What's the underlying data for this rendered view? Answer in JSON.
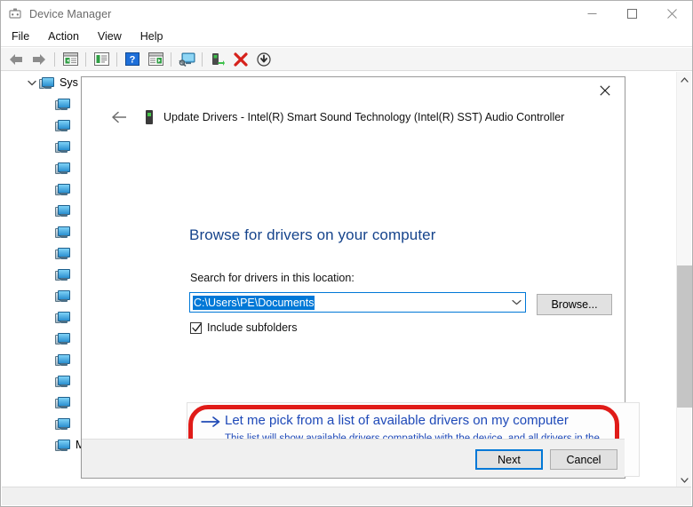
{
  "window": {
    "title": "Device Manager",
    "icon": "device-manager-icon",
    "controls": {
      "minimize": "minimize-icon",
      "maximize": "maximize-icon",
      "close": "close-icon"
    }
  },
  "menubar": {
    "items": [
      {
        "label": "File"
      },
      {
        "label": "Action"
      },
      {
        "label": "View"
      },
      {
        "label": "Help"
      }
    ]
  },
  "toolbar": {
    "buttons": [
      {
        "name": "back-icon",
        "title": "Back"
      },
      {
        "name": "forward-icon",
        "title": "Forward"
      },
      {
        "name": "show-hide-console-tree-icon",
        "title": "Show/Hide Console Tree"
      },
      {
        "name": "properties-icon",
        "title": "Properties"
      },
      {
        "name": "help-icon",
        "title": "Help"
      },
      {
        "name": "update-driver-icon",
        "title": "Update driver"
      },
      {
        "name": "scan-for-hardware-changes-icon",
        "title": "Scan for hardware changes"
      },
      {
        "name": "uninstall-device-icon",
        "title": "Uninstall device"
      },
      {
        "name": "disable-device-icon",
        "title": "Disable device"
      },
      {
        "name": "enable-device-icon",
        "title": "Enable device"
      }
    ]
  },
  "tree": {
    "root_label": "Sys",
    "item_count": 17,
    "last_item_label": "Microsoft UEFI-Compliant System",
    "chevron": "chevron-down-icon",
    "device_icon": "system-device-icon"
  },
  "scrollbar": {
    "up_arrow": "scroll-up-icon",
    "down_arrow": "scroll-down-icon"
  },
  "dialog": {
    "close_icon": "close-icon",
    "back_icon": "back-arrow-icon",
    "device_icon": "device-icon",
    "title": "Update Drivers - Intel(R) Smart Sound Technology (Intel(R) SST) Audio Controller",
    "heading": "Browse for drivers on your computer",
    "search_label": "Search for drivers in this location:",
    "location_value": "C:\\Users\\PE\\Documents",
    "location_placeholder": "",
    "dropdown_icon": "chevron-down-icon",
    "browse_label": "Browse...",
    "include_subfolders_label": "Include subfolders",
    "include_subfolders_checked": true,
    "option": {
      "arrow_icon": "arrow-right-icon",
      "title": "Let me pick from a list of available drivers on my computer",
      "description": "This list will show available drivers compatible with the device, and all drivers in the same category as the device.",
      "highlight_color": "#e01b18"
    },
    "footer": {
      "next_label": "Next",
      "cancel_label": "Cancel",
      "default_button": "Next"
    }
  }
}
